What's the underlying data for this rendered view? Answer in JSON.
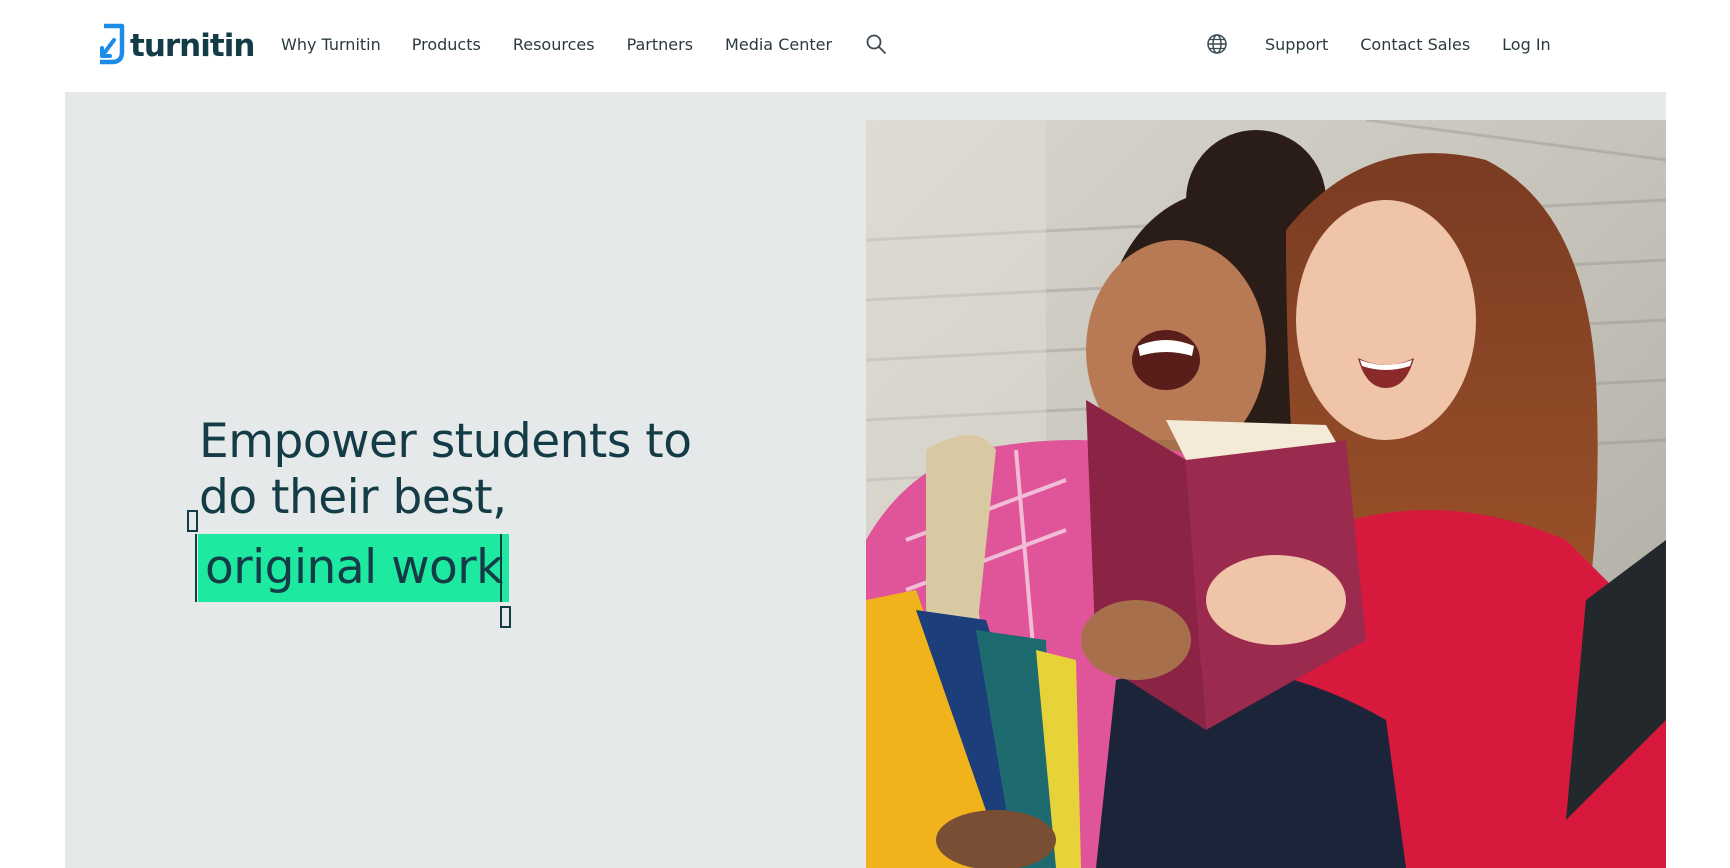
{
  "header": {
    "logo": {
      "text": "turnitin",
      "mark": "turnitin-logo-mark"
    },
    "nav_left": [
      {
        "label": "Why Turnitin"
      },
      {
        "label": "Products"
      },
      {
        "label": "Resources"
      },
      {
        "label": "Partners"
      },
      {
        "label": "Media Center"
      }
    ],
    "search_icon": "search-icon",
    "globe_icon": "globe-icon",
    "nav_right": [
      {
        "label": "Support"
      },
      {
        "label": "Contact Sales"
      },
      {
        "label": "Log In"
      }
    ]
  },
  "hero": {
    "headline_line1": "Empower students to",
    "headline_line2": "do their best,",
    "headline_highlight": "original work",
    "image_alt": "Two students laughing while reading a book outdoors",
    "colors": {
      "background": "#e6e9ea",
      "highlight": "#1de9a1",
      "text": "#143c46",
      "brand_blue": "#1c8ce8"
    }
  }
}
